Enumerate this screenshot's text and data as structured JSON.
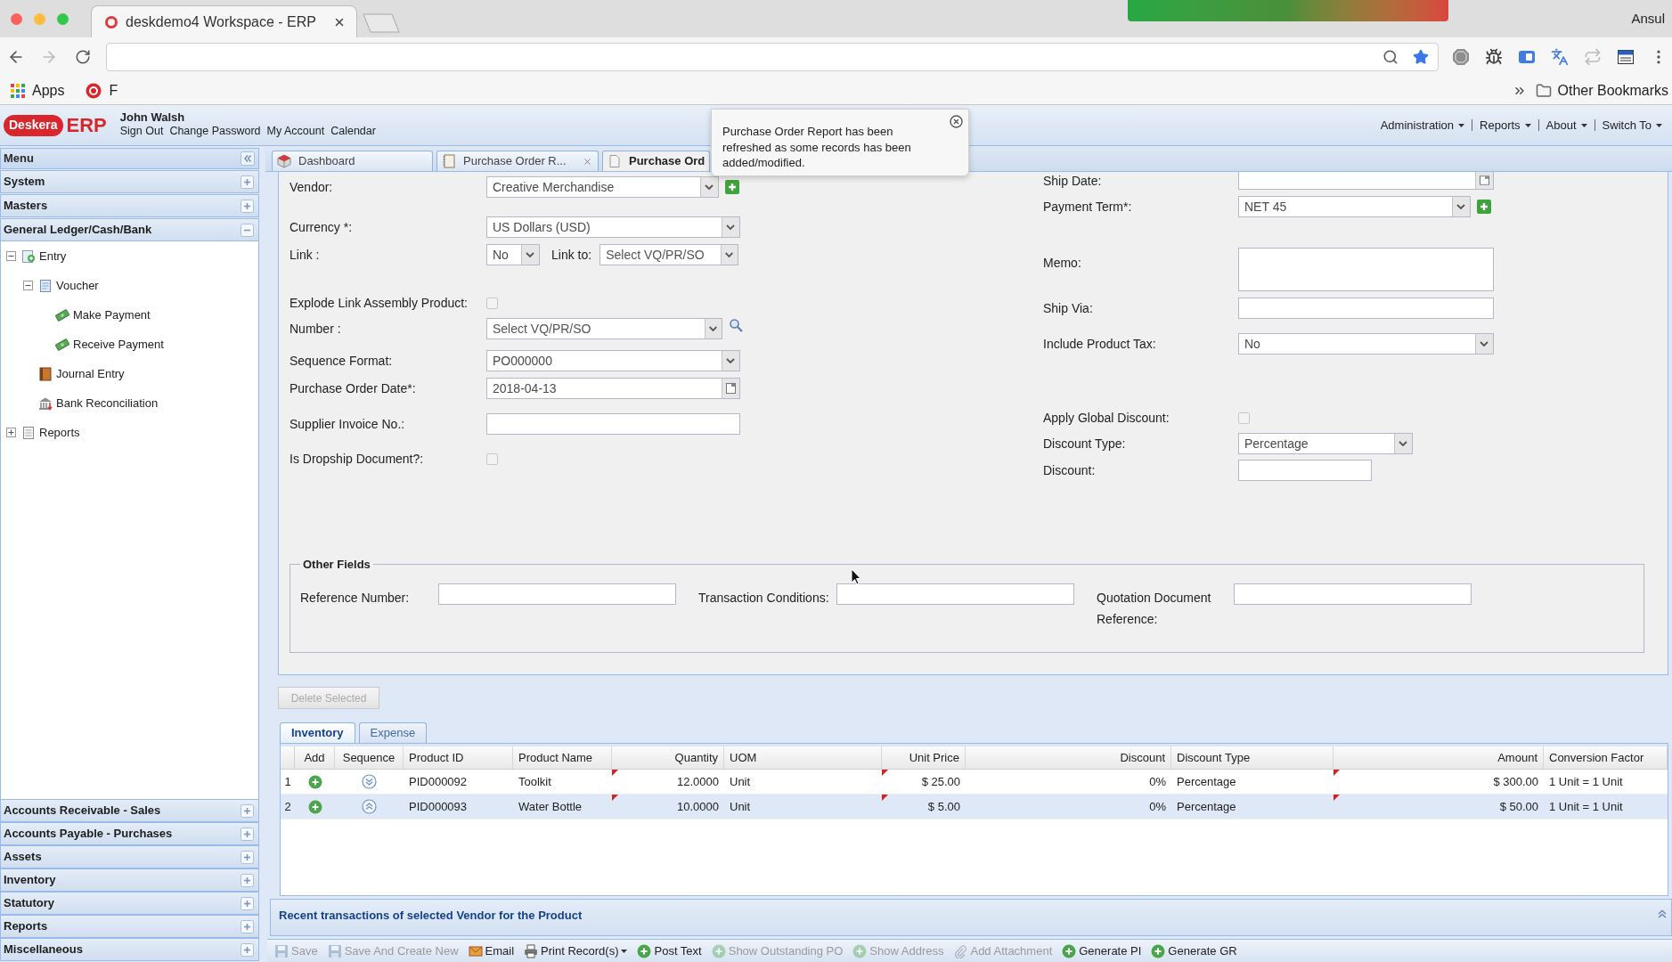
{
  "browser": {
    "tab_title": "deskdemo4 Workspace - ERP",
    "profile": "Ansul",
    "bookmarks": [
      {
        "label": "Apps",
        "kind": "apps"
      },
      {
        "label": "F",
        "kind": "site"
      }
    ],
    "other_bookmarks": "Other Bookmarks"
  },
  "app_header": {
    "logo": {
      "brand": "Deskera",
      "product": "ERP"
    },
    "user_name": "John Walsh",
    "user_links": [
      "Sign Out",
      "Change Password",
      "My Account",
      "Calendar"
    ],
    "menus": [
      "Administration",
      "Reports",
      "About",
      "Switch To"
    ]
  },
  "notification": {
    "message": "Purchase Order Report has been refreshed as some records has been added/modified."
  },
  "sidebar": {
    "title": "Menu",
    "sections": [
      {
        "label": "System",
        "expanded": false
      },
      {
        "label": "Masters",
        "expanded": false
      },
      {
        "label": "General Ledger/Cash/Bank",
        "expanded": true,
        "items": [
          {
            "label": "Entry",
            "kind": "entry",
            "expanded": true,
            "children": [
              {
                "label": "Voucher",
                "kind": "voucher",
                "expanded": true,
                "children": [
                  {
                    "label": "Make Payment",
                    "kind": "payment"
                  },
                  {
                    "label": "Receive Payment",
                    "kind": "payment"
                  }
                ]
              },
              {
                "label": "Journal Entry",
                "kind": "journal"
              },
              {
                "label": "Bank Reconciliation",
                "kind": "bank"
              }
            ]
          },
          {
            "label": "Reports",
            "kind": "report",
            "expanded": false
          }
        ]
      },
      {
        "label": "Accounts Receivable - Sales",
        "expanded": false
      },
      {
        "label": "Accounts Payable - Purchases",
        "expanded": false
      },
      {
        "label": "Assets",
        "expanded": false
      },
      {
        "label": "Inventory",
        "expanded": false
      },
      {
        "label": "Statutory",
        "expanded": false
      },
      {
        "label": "Reports",
        "expanded": false
      },
      {
        "label": "Miscellaneous",
        "expanded": false
      }
    ]
  },
  "workspace_tabs": [
    {
      "label": "Dashboard",
      "kind": "dashboard",
      "selected": false,
      "closable": false
    },
    {
      "label": "Purchase Order R...",
      "kind": "report",
      "selected": false,
      "closable": true
    },
    {
      "label": "Purchase Ord",
      "kind": "document",
      "selected": true,
      "closable": false
    }
  ],
  "form": {
    "left_fields": [
      {
        "kind": "combo",
        "label": "Vendor:",
        "value": "Creative Merchandise",
        "add": true
      },
      {
        "kind": "combo",
        "label": "Currency *:",
        "value": "US Dollars (USD)"
      },
      {
        "kind": "link",
        "label": "Link :",
        "value": "No",
        "link_to_label": "Link to:",
        "link_to_placeholder": "Select VQ/PR/SO"
      },
      {
        "kind": "checkbox",
        "label": "Explode Link Assembly Product:",
        "checked": false
      },
      {
        "kind": "combo",
        "label": "Number :",
        "placeholder": "Select VQ/PR/SO",
        "search": true
      },
      {
        "kind": "combo",
        "label": "Sequence Format:",
        "value": "PO000000"
      },
      {
        "kind": "date",
        "label": "Purchase Order Date*:",
        "value": "2018-04-13"
      },
      {
        "kind": "text",
        "label": "Supplier Invoice No.:"
      },
      {
        "kind": "checkbox",
        "label": "Is Dropship Document?:",
        "checked": false
      }
    ],
    "right_fields": [
      {
        "kind": "date",
        "label": "Ship Date:"
      },
      {
        "kind": "combo",
        "label": "Payment Term*:",
        "value": "NET 45",
        "add": true
      },
      {
        "kind": "textarea",
        "label": "Memo:"
      },
      {
        "kind": "text",
        "label": "Ship Via:"
      },
      {
        "kind": "combo",
        "label": "Include Product Tax:",
        "value": "No"
      },
      {
        "kind": "checkbox",
        "label": "Apply Global Discount:",
        "checked": false
      },
      {
        "kind": "combo",
        "label": "Discount Type:",
        "value": "Percentage"
      },
      {
        "kind": "text",
        "label": "Discount:"
      }
    ],
    "other_fields": {
      "title": "Other Fields",
      "fields": [
        {
          "label": "Reference Number:"
        },
        {
          "label": "Transaction Conditions:"
        },
        {
          "label": "Quotation Document Reference:"
        }
      ]
    }
  },
  "delete_button": {
    "label": "Delete Selected",
    "disabled": true
  },
  "grid": {
    "tabs": [
      {
        "label": "Inventory",
        "selected": true
      },
      {
        "label": "Expense",
        "selected": false
      }
    ],
    "columns": [
      "Add",
      "Sequence",
      "Product ID",
      "Product Name",
      "Quantity",
      "UOM",
      "Unit Price",
      "Discount",
      "Discount Type",
      "Amount",
      "Conversion Factor"
    ],
    "rows": [
      {
        "number": "1",
        "selected": false,
        "cells": [
          {
            "kind": "add_button"
          },
          {
            "kind": "move_down"
          },
          {
            "kind": "text",
            "text": "PID000092",
            "edited": false
          },
          {
            "kind": "text",
            "text": "Toolkit",
            "edited": false
          },
          {
            "kind": "text",
            "text": "12.0000",
            "edited": true
          },
          {
            "kind": "text",
            "text": "Unit",
            "edited": false
          },
          {
            "kind": "text",
            "text": "$ 25.00",
            "edited": true
          },
          {
            "kind": "text",
            "text": "0%",
            "edited": false
          },
          {
            "kind": "text",
            "text": "Percentage",
            "edited": false
          },
          {
            "kind": "text",
            "text": "$ 300.00",
            "edited": true
          },
          {
            "kind": "text",
            "text": "1 Unit = 1 Unit",
            "edited": false
          }
        ]
      },
      {
        "number": "2",
        "selected": true,
        "cells": [
          {
            "kind": "add_button"
          },
          {
            "kind": "move_up"
          },
          {
            "kind": "text",
            "text": "PID000093",
            "edited": false
          },
          {
            "kind": "text",
            "text": "Water Bottle",
            "edited": false
          },
          {
            "kind": "text",
            "text": "10.0000",
            "edited": true
          },
          {
            "kind": "text",
            "text": "Unit",
            "edited": false
          },
          {
            "kind": "text",
            "text": "$ 5.00",
            "edited": true
          },
          {
            "kind": "text",
            "text": "0%",
            "edited": false
          },
          {
            "kind": "text",
            "text": "Percentage",
            "edited": false
          },
          {
            "kind": "text",
            "text": "$ 50.00",
            "edited": true
          },
          {
            "kind": "text",
            "text": "1 Unit = 1 Unit",
            "edited": false
          }
        ]
      }
    ]
  },
  "recent_panel": {
    "title": "Recent transactions of selected Vendor for the Product"
  },
  "toolbar": [
    {
      "label": "Save",
      "kind": "save",
      "disabled": true
    },
    {
      "label": "Save And Create New",
      "kind": "save",
      "disabled": true
    },
    {
      "label": "Email",
      "kind": "email",
      "disabled": false
    },
    {
      "label": "Print Record(s)",
      "kind": "print",
      "disabled": false,
      "menu": true
    },
    {
      "label": "Post Text",
      "kind": "circle",
      "disabled": false
    },
    {
      "label": "Show Outstanding PO",
      "kind": "circle",
      "disabled": true
    },
    {
      "label": "Show Address",
      "kind": "circle",
      "disabled": true
    },
    {
      "label": "Add Attachment",
      "kind": "attach",
      "disabled": true
    },
    {
      "label": "Generate PI",
      "kind": "circle",
      "disabled": false
    },
    {
      "label": "Generate GR",
      "kind": "circle",
      "disabled": false
    }
  ]
}
